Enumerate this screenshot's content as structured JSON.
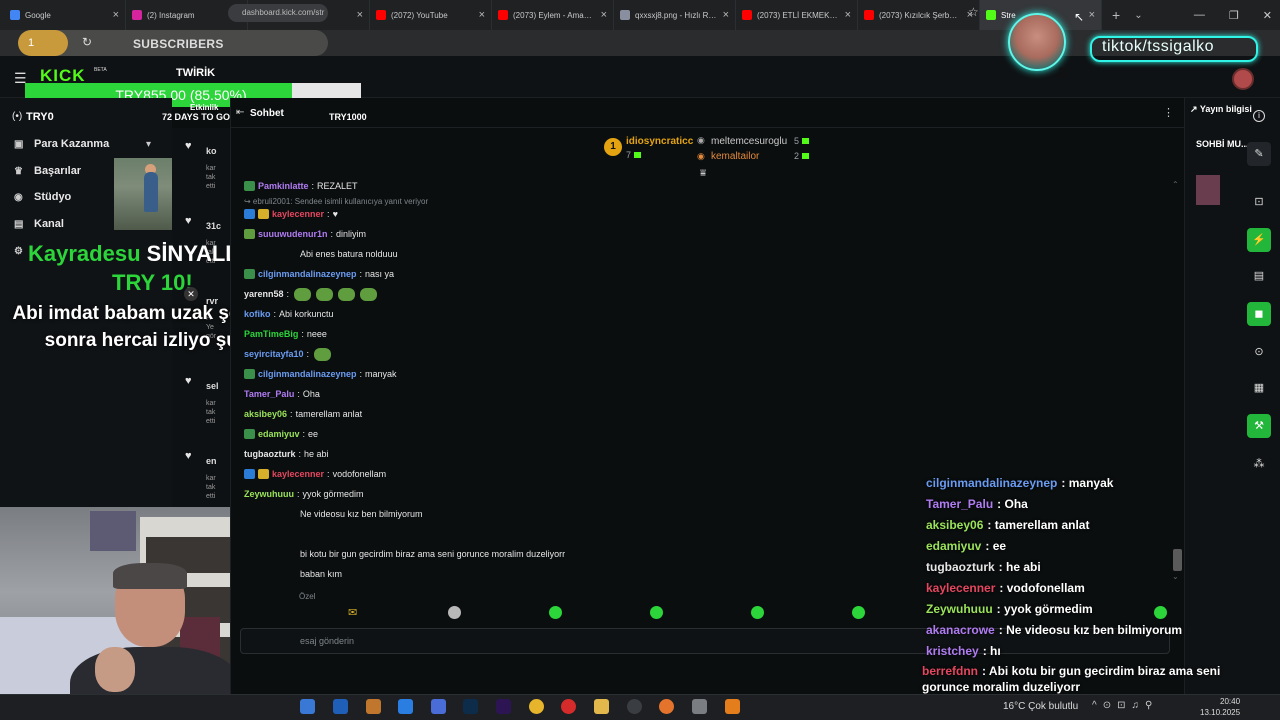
{
  "browser": {
    "tabs": [
      {
        "title": "Google",
        "color": "#4285f4"
      },
      {
        "title": "(2) Instagram",
        "color": "#d6249f"
      },
      {
        "title": "(2) Instagram",
        "color": "#d6249f"
      },
      {
        "title": "(2072) YouTube",
        "color": "#ff0000"
      },
      {
        "title": "(2073) Eylem - Aman (C",
        "color": "#ff0000"
      },
      {
        "title": "qxxsxj8.png - Hızlı Resim",
        "color": "#8a8fa0"
      },
      {
        "title": "(2073) ETLİ EKMEK MUK",
        "color": "#ff0000"
      },
      {
        "title": "(2073) Kızılcık Şerbeti 1",
        "color": "#ff0000"
      },
      {
        "title": "Stre",
        "color": "#53fc18"
      }
    ],
    "url": "dashboard.kick.com/str"
  },
  "overlay_subs": {
    "count": "1",
    "label": "SUBSCRIBERS"
  },
  "tiktok": {
    "handle": "tiktok/tssigalko"
  },
  "kick": {
    "logo": "KICK",
    "logo_tag": "BETA",
    "goal_title": "TWİRİK",
    "goal_text": "TRY855.00 (85.50%)",
    "goal_fraction": 0.855,
    "goal_left": "TRY0",
    "goal_days": "72 DAYS TO GO",
    "goal_right_label": "Etkinlik",
    "chat_goal": "TRY1000"
  },
  "sidebar": {
    "head": "(•)",
    "items": [
      {
        "label": "Para Kazanma",
        "icon": "money-icon"
      },
      {
        "label": "Başarılar",
        "icon": "trophy-icon"
      },
      {
        "label": "Stüdyo",
        "icon": "studio-icon"
      },
      {
        "label": "Kanal",
        "icon": "channel-icon"
      }
    ]
  },
  "alert": {
    "username": "Kayradesu",
    "action": "SİNYALLEDİ",
    "amount": "TRY 10!",
    "message": "Abi imdat babam uzak şehirden sonra hercai izliyo şu an"
  },
  "streams": [
    {
      "t": "ko",
      "s": "kar\ntak\netti"
    },
    {
      "t": "31c",
      "s": "kar\ntak\netti"
    },
    {
      "t": "rvr",
      "s": "H\nYe\ngör"
    },
    {
      "t": "sel",
      "s": "kar\ntak\netti"
    },
    {
      "t": "en",
      "s": "kar\ntak\netti"
    }
  ],
  "chat": {
    "title": "Sohbet",
    "leaderboard": [
      {
        "rank": "1",
        "name": "idiosyncraticc",
        "value": "7",
        "color": "#e4a411"
      },
      {
        "name": "meltemcesuroglu",
        "value": "5",
        "color": "#c9c9c9"
      },
      {
        "name": "kemaltailor",
        "value": "2",
        "color": "#e48a3a"
      }
    ],
    "reply_note": "↪ ebruli2001: Sendee isimli kullanıcıya yanıt veriyor",
    "messages": [
      {
        "user": "Pamkinlatte",
        "text": "REZALET",
        "color": "#b07cf2",
        "badge": "#3a8f4a"
      },
      {
        "user": "kaylecenner",
        "text": "♥",
        "color": "#e4475f",
        "badge": "#2b7cd6",
        "badge2": "#d6b02b"
      },
      {
        "user": "suuuwudenur1n",
        "text": "dinliyim",
        "color": "#b07cf2",
        "badge": "#5f9d3f"
      },
      {
        "user": "",
        "text": "Abi enes batura nolduuu",
        "color": "#e6e6e6"
      },
      {
        "user": "cilginmandalinazeynep",
        "text": "nası ya",
        "color": "#6a9cf2",
        "badge": "#3a8f4a"
      },
      {
        "user": "yarenn58",
        "text": "",
        "color": "#e6e6e6",
        "emotes": 4
      },
      {
        "user": "kofiko",
        "text": "Abi korkunctu",
        "color": "#6a9cf2"
      },
      {
        "user": "PamTimeBig",
        "text": "neee",
        "color": "#2bd53a"
      },
      {
        "user": "seyircitayfa10",
        "text": "",
        "color": "#6a9cf2",
        "emotes": 1
      },
      {
        "user": "cilginmandalinazeynep",
        "text": "manyak",
        "color": "#6a9cf2",
        "badge": "#3a8f4a"
      },
      {
        "user": "Tamer_Palu",
        "text": "Oha",
        "color": "#b07cf2"
      },
      {
        "user": "aksibey06",
        "text": "tamerellam anlat",
        "color": "#9ae35a"
      },
      {
        "user": "edamiyuv",
        "text": "ee",
        "color": "#9ae35a",
        "badge": "#3a8f4a"
      },
      {
        "user": "tugbaozturk",
        "text": "he abi",
        "color": "#e6e6e6"
      },
      {
        "user": "kaylecenner",
        "text": "vodofonellam",
        "color": "#e4475f",
        "badge": "#2b7cd6",
        "badge2": "#d6b02b"
      },
      {
        "user": "Zeywuhuuu",
        "text": "yyok görmedim",
        "color": "#9ae35a"
      },
      {
        "user": "",
        "text": "Ne videosu kız ben bilmiyorum",
        "color": "#e6e6e6"
      },
      {
        "user": "",
        "text": "",
        "color": "#e6e6e6"
      },
      {
        "user": "",
        "text": "bi kotu bir gun gecirdim biraz ama seni gorunce moralim duzeliyorr",
        "color": "#e6e6e6"
      },
      {
        "user": "",
        "text": "baban kım",
        "color": "#e6e6e6"
      }
    ],
    "private_label": "Özel",
    "input_placeholder": "esaj gönderin"
  },
  "rail": {
    "title": "Yayın bilgisi",
    "sohbet": "SOHBİ MU..."
  },
  "overlay_chat": [
    {
      "user": "cilginmandalinazeynep",
      "text": "manyak",
      "color": "#6a9cf2"
    },
    {
      "user": "Tamer_Palu",
      "text": "Oha",
      "color": "#b07cf2"
    },
    {
      "user": "aksibey06",
      "text": "tamerellam anlat",
      "color": "#9ae35a"
    },
    {
      "user": "edamiyuv",
      "text": "ee",
      "color": "#9ae35a"
    },
    {
      "user": "tugbaozturk",
      "text": "he abi",
      "color": "#e6e6e6"
    },
    {
      "user": "kaylecenner",
      "text": "vodofonellam",
      "color": "#e4475f"
    },
    {
      "user": "Zeywuhuuu",
      "text": "yyok görmedim",
      "color": "#9ae35a"
    },
    {
      "user": "akanacrowe",
      "text": "Ne videosu kız ben bilmiyorum",
      "color": "#b07cf2"
    },
    {
      "user": "kristchey",
      "text": "hı",
      "color": "#b07cf2"
    },
    {
      "user": "berrefdnn",
      "text": "Abi kotu bir gun gecirdim biraz ama seni gorunce moralim duzeliyorr",
      "color": "#e4475f"
    }
  ],
  "taskbar": {
    "weather": "16°C  Çok bulutlu",
    "time": "20:40",
    "date": "13.10.2025"
  }
}
